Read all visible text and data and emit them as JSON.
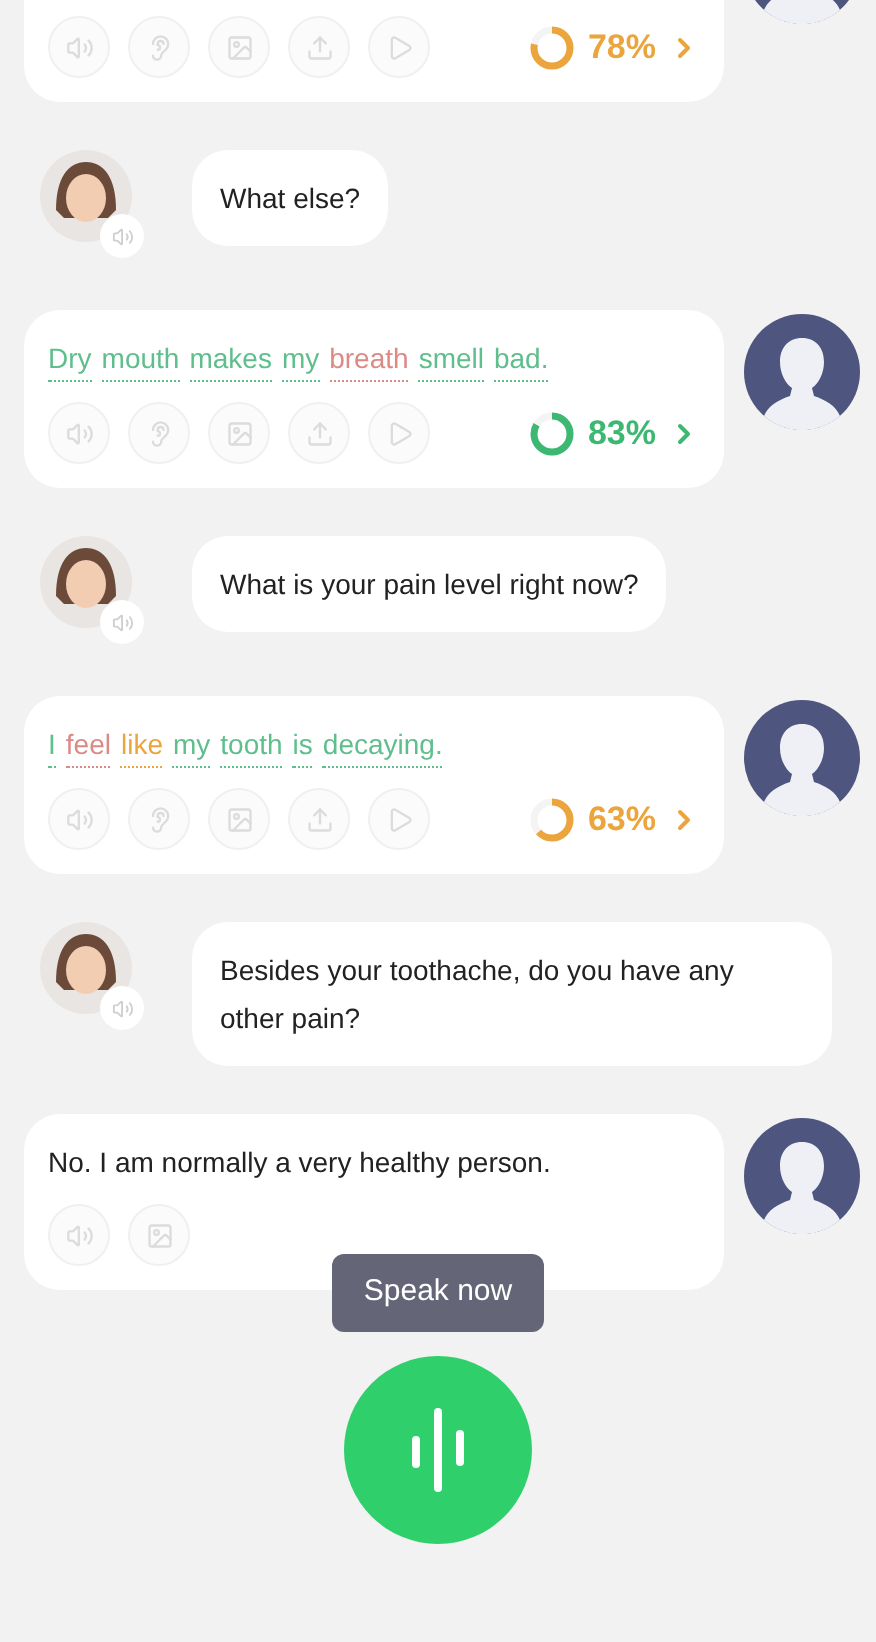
{
  "messages": [
    {
      "kind": "user",
      "actions": [
        {
          "kind": "speaker"
        },
        {
          "kind": "ear"
        },
        {
          "kind": "image"
        },
        {
          "kind": "upload"
        },
        {
          "kind": "play"
        }
      ],
      "score": {
        "text": "78%",
        "level": 0.78,
        "color": "#eba53c"
      }
    },
    {
      "kind": "bot",
      "text": "What else?"
    },
    {
      "kind": "user",
      "words": [
        {
          "text": "Dry",
          "color": "#5fbf8c"
        },
        {
          "text": "mouth",
          "color": "#5fbf8c"
        },
        {
          "text": "makes",
          "color": "#5fbf8c"
        },
        {
          "text": "my",
          "color": "#5fbf8c"
        },
        {
          "text": "breath",
          "color": "#db8a86"
        },
        {
          "text": "smell",
          "color": "#5fbf8c"
        },
        {
          "text": "bad.",
          "color": "#5fbf8c"
        }
      ],
      "actions": [
        {
          "kind": "speaker"
        },
        {
          "kind": "ear"
        },
        {
          "kind": "image"
        },
        {
          "kind": "upload"
        },
        {
          "kind": "play"
        }
      ],
      "score": {
        "text": "83%",
        "level": 0.83,
        "color": "#3cb872"
      }
    },
    {
      "kind": "bot",
      "text": "What is your pain level right now?"
    },
    {
      "kind": "user",
      "words": [
        {
          "text": "I",
          "color": "#5fbf8c"
        },
        {
          "text": "feel",
          "color": "#db8a86"
        },
        {
          "text": "like",
          "color": "#eba53c"
        },
        {
          "text": "my",
          "color": "#5fbf8c"
        },
        {
          "text": "tooth",
          "color": "#5fbf8c"
        },
        {
          "text": "is",
          "color": "#5fbf8c"
        },
        {
          "text": "decaying.",
          "color": "#5fbf8c"
        }
      ],
      "actions": [
        {
          "kind": "speaker"
        },
        {
          "kind": "ear"
        },
        {
          "kind": "image"
        },
        {
          "kind": "upload"
        },
        {
          "kind": "play"
        }
      ],
      "score": {
        "text": "63%",
        "level": 0.63,
        "color": "#eba53c"
      }
    },
    {
      "kind": "bot",
      "text": "Besides your toothache, do you have any other pain?"
    },
    {
      "kind": "user",
      "text": "No. I am normally a very healthy person.",
      "actions": [
        {
          "kind": "speaker"
        },
        {
          "kind": "image"
        }
      ]
    }
  ],
  "speak_hint": "Speak now"
}
